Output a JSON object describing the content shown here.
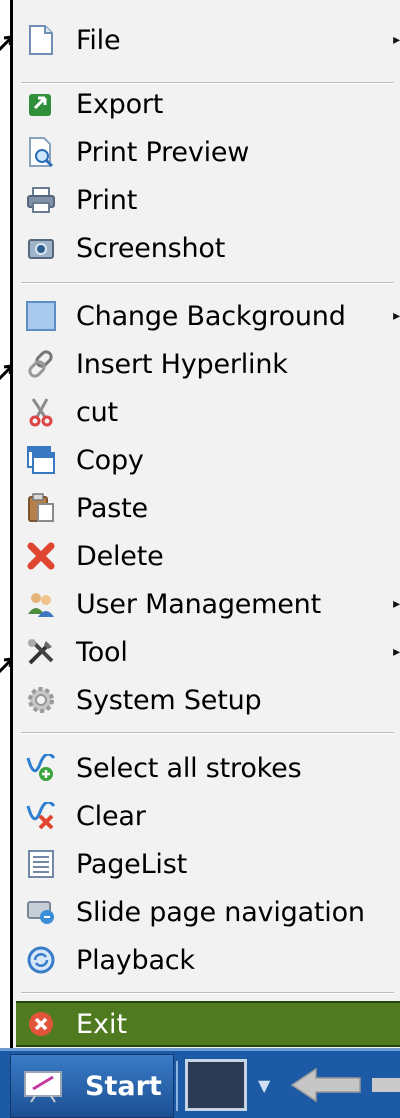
{
  "menu": {
    "items": [
      {
        "label": "File",
        "icon": "document-icon",
        "submenu": true
      },
      {
        "label": "Export",
        "icon": "export-icon",
        "submenu": false
      },
      {
        "label": "Print Preview",
        "icon": "print-preview-icon",
        "submenu": false
      },
      {
        "label": "Print",
        "icon": "printer-icon",
        "submenu": false
      },
      {
        "label": "Screenshot",
        "icon": "camera-icon",
        "submenu": false
      },
      {
        "label": "Change Background",
        "icon": "background-icon",
        "submenu": true
      },
      {
        "label": "Insert Hyperlink",
        "icon": "link-icon",
        "submenu": false
      },
      {
        "label": "cut",
        "icon": "scissors-icon",
        "submenu": false
      },
      {
        "label": "Copy",
        "icon": "copy-icon",
        "submenu": false
      },
      {
        "label": "Paste",
        "icon": "paste-icon",
        "submenu": false
      },
      {
        "label": "Delete",
        "icon": "delete-x-icon",
        "submenu": false
      },
      {
        "label": "User Management",
        "icon": "users-icon",
        "submenu": true
      },
      {
        "label": "Tool",
        "icon": "tools-icon",
        "submenu": true
      },
      {
        "label": "System Setup",
        "icon": "gear-icon",
        "submenu": false
      },
      {
        "label": "Select all strokes",
        "icon": "select-strokes-icon",
        "submenu": false
      },
      {
        "label": "Clear",
        "icon": "clear-icon",
        "submenu": false
      },
      {
        "label": "PageList",
        "icon": "page-list-icon",
        "submenu": false
      },
      {
        "label": "Slide page navigation",
        "icon": "slide-navigation-icon",
        "submenu": false
      },
      {
        "label": "Playback",
        "icon": "playback-icon",
        "submenu": false
      }
    ],
    "exit": {
      "label": "Exit",
      "icon": "exit-icon"
    }
  },
  "taskbar": {
    "start_label": "Start",
    "start_icon": "whiteboard-icon"
  },
  "colors": {
    "menu_bg": "#f2f2f2",
    "exit_bg": "#4f7a1f",
    "taskbar_bg": "#1d5aa5"
  }
}
